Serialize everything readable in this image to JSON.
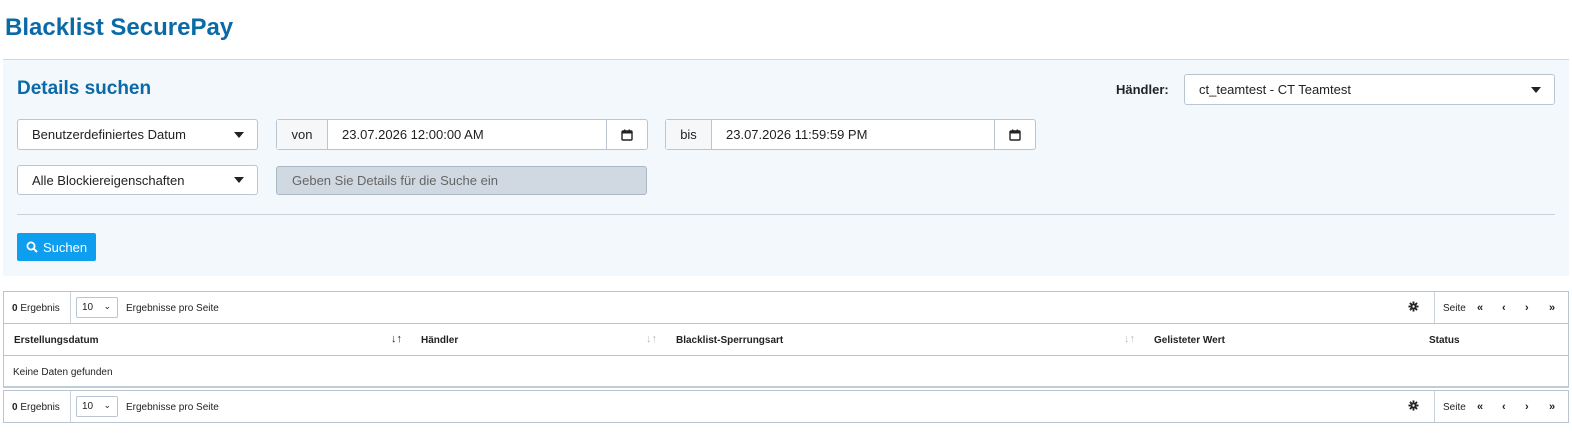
{
  "page": {
    "title": "Blacklist SecurePay"
  },
  "search": {
    "title": "Details suchen",
    "merchant_label": "Händler:",
    "merchant_value": "ct_teamtest - CT Teamtest",
    "date_mode": "Benutzerdefiniertes Datum",
    "from_label": "von",
    "from_value": "23.07.2026 12:00:00 AM",
    "to_label": "bis",
    "to_value": "23.07.2026 11:59:59 PM",
    "block_property": "Alle Blockiereigenschaften",
    "detail_placeholder": "Geben Sie Details für die Suche ein",
    "button_label": "Suchen"
  },
  "toolbar": {
    "count": "0",
    "count_label": "Ergebnis",
    "per_page": "10",
    "per_page_label": "Ergebnisse pro Seite",
    "page_label": "Seite",
    "first": "«",
    "prev": "‹",
    "next": "›",
    "last": "»"
  },
  "table": {
    "columns": [
      "Erstellungsdatum",
      "Händler",
      "Blacklist-Sperrungsart",
      "Gelisteter Wert",
      "Status"
    ],
    "empty_text": "Keine Daten gefunden"
  },
  "icons": {
    "calendar": "calendar-icon",
    "search": "search-icon",
    "gear": "gear-icon",
    "sort": "sort-icon"
  },
  "colors": {
    "brand": "#0a6aa8",
    "button": "#0d9ef0",
    "panel": "#f3f8fc"
  }
}
